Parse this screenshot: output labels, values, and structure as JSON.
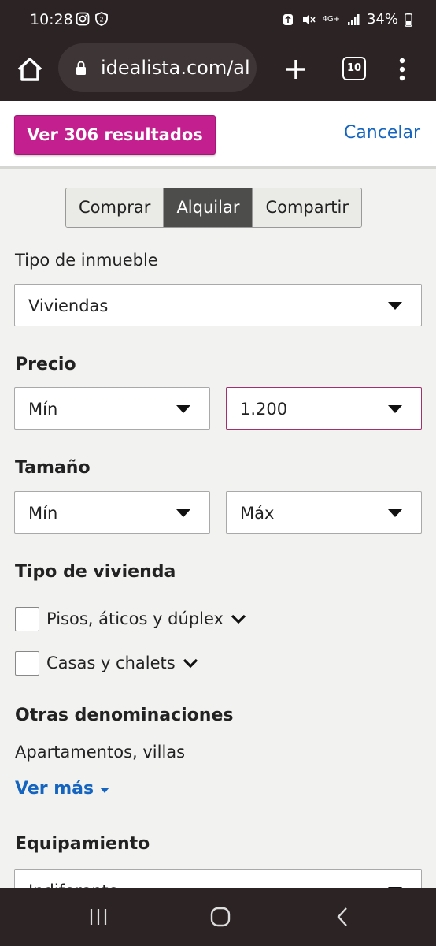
{
  "status_bar": {
    "time": "10:28",
    "network": "4G+",
    "battery": "34%"
  },
  "browser": {
    "url": "idealista.com/alquiler",
    "tab_count": "10"
  },
  "actions": {
    "results_label": "Ver 306 resultados",
    "cancel_label": "Cancelar"
  },
  "operation_tabs": [
    {
      "label": "Comprar",
      "active": false
    },
    {
      "label": "Alquilar",
      "active": true
    },
    {
      "label": "Compartir",
      "active": false
    }
  ],
  "property_type": {
    "label": "Tipo de inmueble",
    "value": "Viviendas"
  },
  "price": {
    "label": "Precio",
    "min": "Mín",
    "max": "1.200"
  },
  "size": {
    "label": "Tamaño",
    "min": "Mín",
    "max": "Máx"
  },
  "housing_type": {
    "label": "Tipo de vivienda",
    "options": [
      {
        "label": "Pisos, áticos y dúplex"
      },
      {
        "label": "Casas y chalets"
      }
    ]
  },
  "other_names": {
    "label": "Otras denominaciones",
    "text": "Apartamentos, villas",
    "more_label": "Ver más"
  },
  "equipment": {
    "label": "Equipamiento",
    "value": "Indiferente"
  },
  "colors": {
    "accent": "#c41f8e",
    "link": "#1565c0",
    "chrome": "#2b2324"
  }
}
